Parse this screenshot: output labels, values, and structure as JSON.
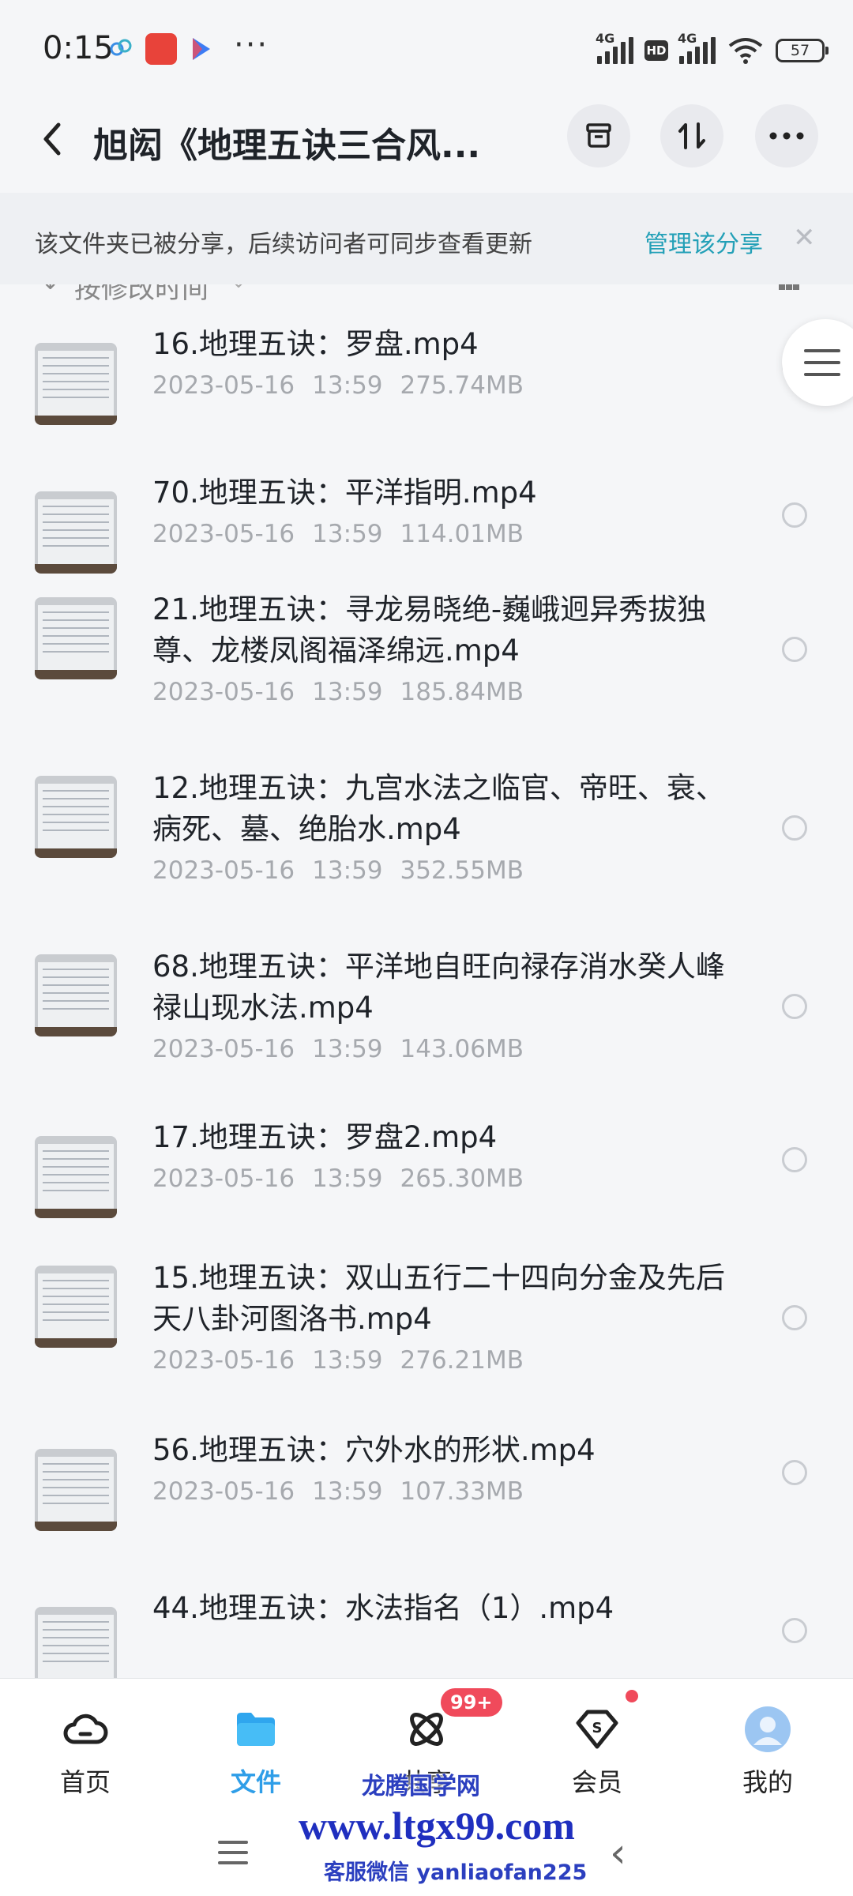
{
  "status_bar": {
    "time": "0:15",
    "dots": "···",
    "signal1_label": "4G",
    "hd_label": "HD",
    "signal2_label": "4G",
    "battery": "57"
  },
  "header": {
    "title": "旭闳《地理五诀三合风..."
  },
  "share_banner": {
    "text": "该文件夹已被分享，后续访问者可同步查看更新",
    "link": "管理该分享",
    "close": "✕"
  },
  "sort": {
    "label": "按修改时间"
  },
  "files": [
    {
      "name": "16.地理五诀：罗盘.mp4",
      "date": "2023-05-16",
      "time": "13:59",
      "size": "275.74MB"
    },
    {
      "name": "70.地理五诀：平洋指明.mp4",
      "date": "2023-05-16",
      "time": "13:59",
      "size": "114.01MB"
    },
    {
      "name": "21.地理五诀：寻龙易晓绝-巍峨迥异秀拔独尊、龙楼凤阁福泽绵远.mp4",
      "date": "2023-05-16",
      "time": "13:59",
      "size": "185.84MB"
    },
    {
      "name": "12.地理五诀：九宫水法之临官、帝旺、衰、病死、墓、绝胎水.mp4",
      "date": "2023-05-16",
      "time": "13:59",
      "size": "352.55MB"
    },
    {
      "name": "68.地理五诀：平洋地自旺向禄存消水癸人峰禄山现水法.mp4",
      "date": "2023-05-16",
      "time": "13:59",
      "size": "143.06MB"
    },
    {
      "name": "17.地理五诀：罗盘2.mp4",
      "date": "2023-05-16",
      "time": "13:59",
      "size": "265.30MB"
    },
    {
      "name": "15.地理五诀：双山五行二十四向分金及先后天八卦河图洛书.mp4",
      "date": "2023-05-16",
      "time": "13:59",
      "size": "276.21MB"
    },
    {
      "name": "56.地理五诀：穴外水的形状.mp4",
      "date": "2023-05-16",
      "time": "13:59",
      "size": "107.33MB"
    },
    {
      "name": "44.地理五诀：水法指名（1）.mp4",
      "date": "",
      "time": "",
      "size": ""
    }
  ],
  "bottom_nav": {
    "tabs": [
      {
        "label": "首页",
        "icon": "cloud-home-icon"
      },
      {
        "label": "文件",
        "icon": "folder-icon"
      },
      {
        "label": "共享",
        "icon": "atom-share-icon"
      },
      {
        "label": "会员",
        "icon": "vip-diamond-icon"
      },
      {
        "label": "我的",
        "icon": "avatar-icon"
      }
    ],
    "active": "文件",
    "share_badge": "99+"
  },
  "watermark": {
    "line1": "龙腾国学网",
    "line2": "www.ltgx99.com",
    "line3": "客服微信 yanliaofan225"
  },
  "colors": {
    "accent": "#2f9ee8",
    "link": "#23a0b7",
    "badge": "#f04a5b"
  }
}
